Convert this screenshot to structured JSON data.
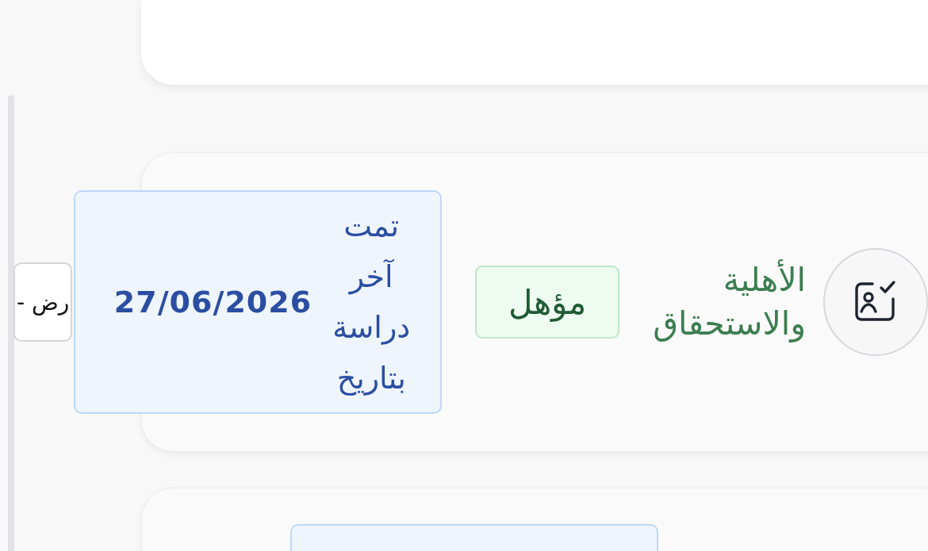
{
  "cards": [
    {
      "kind": "eligibility",
      "title": "الأهلية والاستحقاق",
      "status_badge": "مؤهل",
      "last_review": {
        "label": "تمت آخر دراسة بتاريخ",
        "date": "27/06/2026"
      },
      "action_button": "رض -"
    },
    {
      "kind": "panel_only"
    }
  ]
}
